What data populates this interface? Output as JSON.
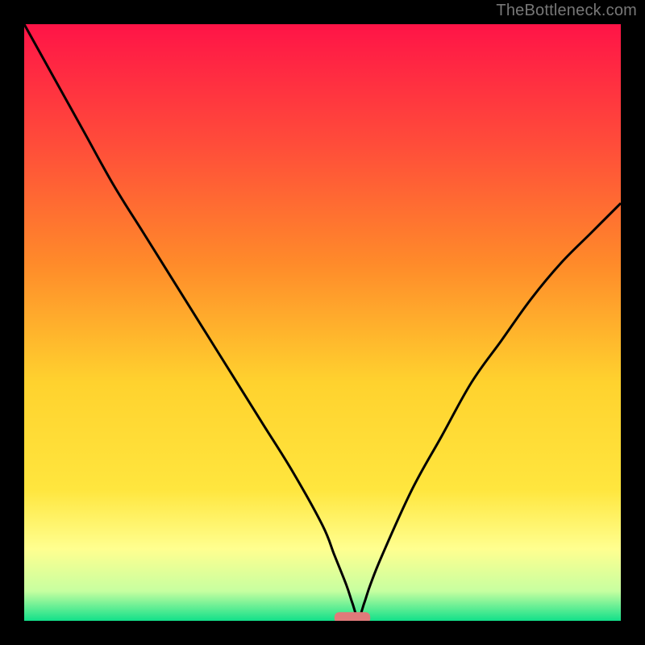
{
  "watermark": "TheBottleneck.com",
  "chart_data": {
    "type": "line",
    "title": "",
    "xlabel": "",
    "ylabel": "",
    "xlim": [
      0,
      100
    ],
    "ylim": [
      0,
      100
    ],
    "grid": false,
    "series": [
      {
        "name": "bottleneck-curve",
        "x": [
          0,
          5,
          10,
          15,
          20,
          25,
          30,
          35,
          40,
          45,
          50,
          52,
          54,
          55,
          56,
          57,
          58,
          60,
          65,
          70,
          75,
          80,
          85,
          90,
          95,
          100
        ],
        "y": [
          100,
          91,
          82,
          73,
          65,
          57,
          49,
          41,
          33,
          25,
          16,
          11,
          6,
          3,
          0.5,
          3,
          6,
          11,
          22,
          31,
          40,
          47,
          54,
          60,
          65,
          70
        ]
      }
    ],
    "marker": {
      "name": "optimal-range",
      "x_center": 55,
      "width": 6,
      "y": 0.5,
      "color": "#e07a7a",
      "shape": "rounded-bar"
    },
    "background_gradient": {
      "top": "#ff1447",
      "upper_mid": "#ff8a2a",
      "mid": "#ffe63e",
      "lower_mid": "#ffff90",
      "bottom": "#12e08a"
    }
  }
}
